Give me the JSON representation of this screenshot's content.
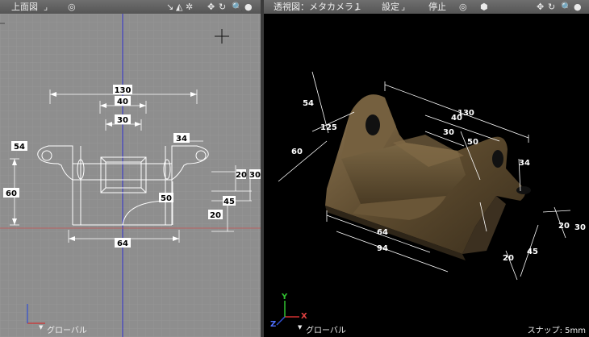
{
  "left_view": {
    "title": "上面図",
    "bottom_label": "グローバル",
    "dims": {
      "d130": "130",
      "d40": "40",
      "d30": "30",
      "d34": "34",
      "d54": "54",
      "d60": "60",
      "d20a": "20",
      "d30b": "30",
      "d45": "45",
      "d50": "50",
      "d20b": "20",
      "d64": "64"
    }
  },
  "right_view": {
    "title": "透視図：メタカメラ１",
    "menu_settings": "設定",
    "menu_stop": "停止",
    "bottom_label": "グローバル",
    "snap": "スナップ: 5mm",
    "axis_labels": {
      "x": "X",
      "y": "Y",
      "z": "Z"
    },
    "dims": {
      "d54": "54",
      "d125": "125",
      "d60": "60",
      "d130": "130",
      "d40": "40",
      "d30": "30",
      "d50": "50",
      "d34": "34",
      "d64": "64",
      "d94": "94",
      "d20a": "20",
      "d30b": "30",
      "d20b": "20",
      "d45": "45"
    }
  },
  "colors": {
    "grid_bg": "#8e8e8e",
    "axis_blue": "#3333cc",
    "axis_red": "#cc3333",
    "part": "#6b5a3a"
  }
}
